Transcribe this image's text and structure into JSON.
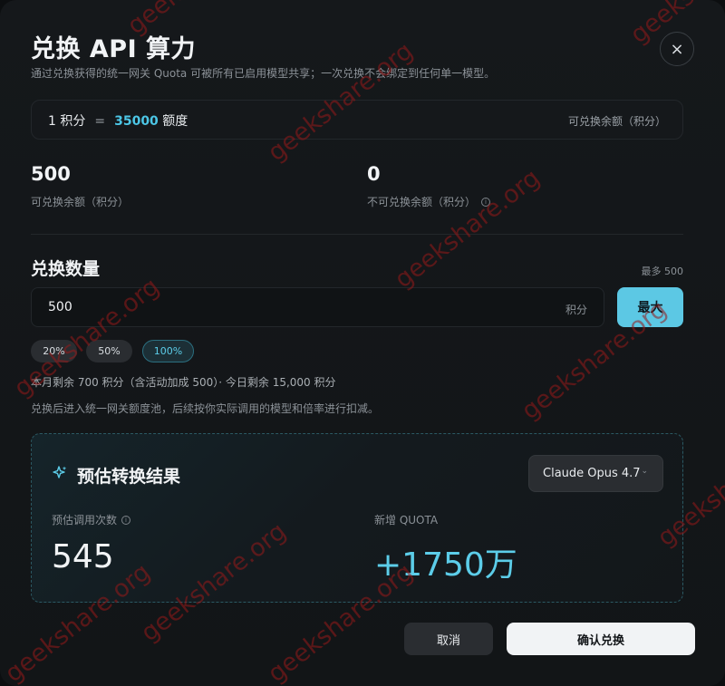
{
  "dialog": {
    "title": "兑换 API 算力",
    "subtitle": "通过兑换获得的统一网关 Quota 可被所有已启用模型共享；一次兑换不会绑定到任何单一模型。",
    "close_glyph": "×"
  },
  "rate": {
    "left_amount": "1 积分",
    "equals": "=",
    "quota_value": "35000",
    "quota_unit": "额度",
    "right_label": "可兑换余额（积分）"
  },
  "balances": {
    "exchangeable": {
      "value": "500",
      "label": "可兑换余额（积分）"
    },
    "non_exchangeable": {
      "value": "0",
      "label": "不可兑换余额（积分）",
      "info_glyph": "i"
    }
  },
  "amount": {
    "title": "兑换数量",
    "max_hint": "最多 500",
    "input_value": "500",
    "unit": "积分",
    "max_button": "最大",
    "presets": [
      {
        "label": "20%",
        "active": false
      },
      {
        "label": "50%",
        "active": false
      },
      {
        "label": "100%",
        "active": true
      }
    ],
    "note_remaining": "本月剩余 700 积分（含活动加成 500）· 今日剩余 15,000 积分",
    "note_pool": "兑换后进入统一网关额度池，后续按你实际调用的模型和倍率进行扣减。"
  },
  "result": {
    "title": "预估转换结果",
    "model_selected": "Claude Opus 4.7",
    "calls_label": "预估调用次数",
    "calls_value": "545",
    "quota_label": "新增 QUOTA",
    "quota_value": "+1750万",
    "accent_color": "#5ccde9"
  },
  "actions": {
    "cancel": "取消",
    "confirm": "确认兑换"
  },
  "watermark": "geekshare.org"
}
